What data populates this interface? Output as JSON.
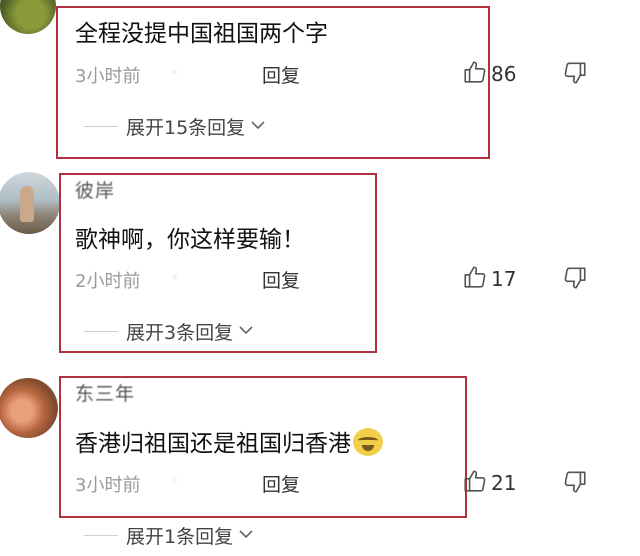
{
  "comments": [
    {
      "username": "",
      "content": "全程没提中国祖国两个字",
      "time": "3小时前",
      "location": "·",
      "reply_label": "回复",
      "likes": "86",
      "expand_label": "展开15条回复"
    },
    {
      "username": "彼岸",
      "content": "歌神啊，你这样要输！",
      "time": "2小时前",
      "location": "·",
      "reply_label": "回复",
      "likes": "17",
      "expand_label": "展开3条回复"
    },
    {
      "username": "东三年",
      "content": "香港归祖国还是祖国归香港",
      "time": "3小时前",
      "location": "·",
      "reply_label": "回复",
      "likes": "21",
      "expand_label": "展开1条回复"
    }
  ],
  "colors": {
    "highlight_border": "#b0323e",
    "meta_text": "#9a9a9a"
  },
  "icons": [
    "thumbs-up-icon",
    "thumbs-down-icon",
    "chevron-down-icon",
    "laughing-emoji-icon"
  ]
}
